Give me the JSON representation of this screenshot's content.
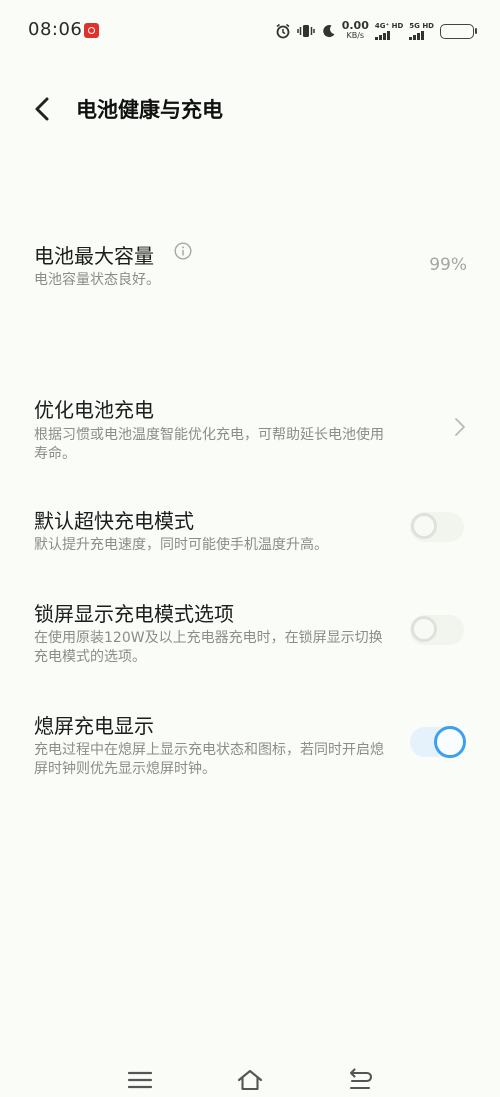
{
  "status_bar": {
    "time": "08:06",
    "net_speed_value": "0.00",
    "net_speed_unit": "KB/s",
    "signal1_label": "4G⁺ HD",
    "signal2_label": "5G HD",
    "battery_level_percent": 100
  },
  "header": {
    "title": "电池健康与充电"
  },
  "settings": {
    "max_capacity": {
      "title": "电池最大容量",
      "desc": "电池容量状态良好。",
      "value": "99%"
    },
    "optimize_charging": {
      "title": "优化电池充电",
      "desc": "根据习惯或电池温度智能优化充电，可帮助延长电池使用寿命。"
    },
    "default_super_fast": {
      "title": "默认超快充电模式",
      "desc": "默认提升充电速度，同时可能使手机温度升高。",
      "enabled": false
    },
    "lockscreen_mode_option": {
      "title": "锁屏显示充电模式选项",
      "desc": "在使用原装120W及以上充电器充电时，在锁屏显示切换充电模式的选项。",
      "enabled": false
    },
    "screen_off_display": {
      "title": "熄屏充电显示",
      "desc": "充电过程中在熄屏上显示充电状态和图标，若同时开启熄屏时钟则优先显示熄屏时钟。",
      "enabled": true
    }
  },
  "colors": {
    "background": "#f9fcf7",
    "toggle_on_accent": "#3da0ee"
  },
  "icons": {
    "back": "chevron-left-icon",
    "info": "info-icon",
    "chevron": "chevron-right-icon",
    "menu": "menu-icon",
    "home": "home-icon",
    "back_nav": "back-nav-icon"
  }
}
